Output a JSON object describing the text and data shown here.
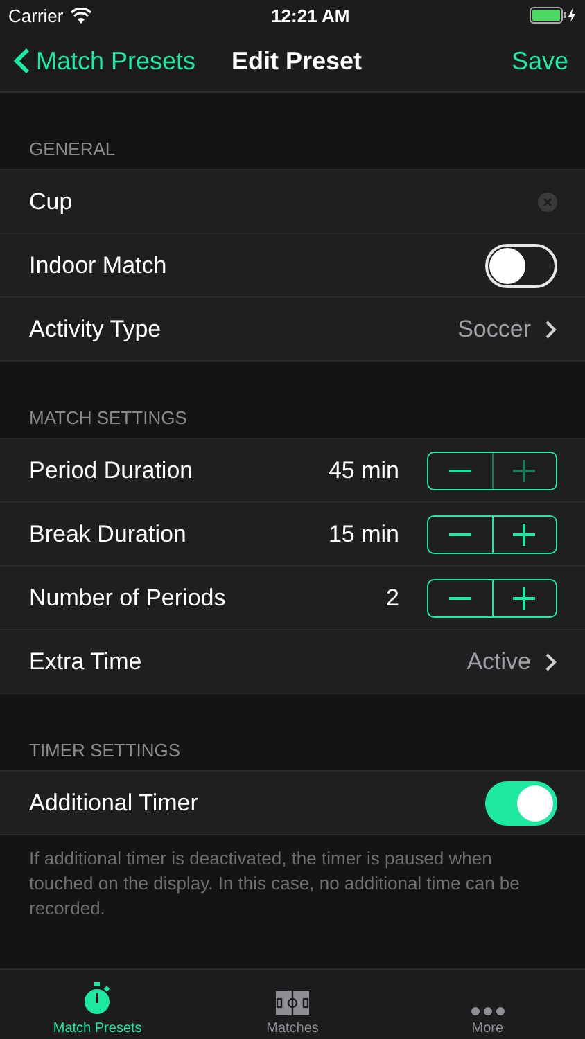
{
  "status_bar": {
    "carrier": "Carrier",
    "time": "12:21 AM"
  },
  "nav": {
    "back": "Match Presets",
    "title": "Edit Preset",
    "action": "Save"
  },
  "sections": [
    {
      "header": "GENERAL",
      "rows": [
        {
          "kind": "text-field",
          "label": "Cup"
        },
        {
          "kind": "switch",
          "label": "Indoor Match",
          "on": false
        },
        {
          "kind": "disclosure",
          "label": "Activity Type",
          "value": "Soccer"
        }
      ]
    },
    {
      "header": "MATCH SETTINGS",
      "rows": [
        {
          "kind": "stepper",
          "label": "Period Duration",
          "value": "45 min",
          "minus_disabled": false,
          "plus_disabled": true
        },
        {
          "kind": "stepper",
          "label": "Break Duration",
          "value": "15 min",
          "minus_disabled": false,
          "plus_disabled": false
        },
        {
          "kind": "stepper",
          "label": "Number of Periods",
          "value": "2",
          "minus_disabled": false,
          "plus_disabled": false
        },
        {
          "kind": "disclosure",
          "label": "Extra Time",
          "value": "Active"
        }
      ]
    },
    {
      "header": "TIMER SETTINGS",
      "rows": [
        {
          "kind": "switch",
          "label": "Additional Timer",
          "on": true
        }
      ],
      "footer": "If additional timer is deactivated, the timer is paused when touched on the display. In this case, no additional time can be recorded."
    }
  ],
  "tabs": [
    {
      "label": "Match Presets",
      "kind": "stopwatch",
      "selected": true
    },
    {
      "label": "Matches",
      "kind": "field",
      "selected": false
    },
    {
      "label": "More",
      "kind": "dots",
      "selected": false
    }
  ]
}
